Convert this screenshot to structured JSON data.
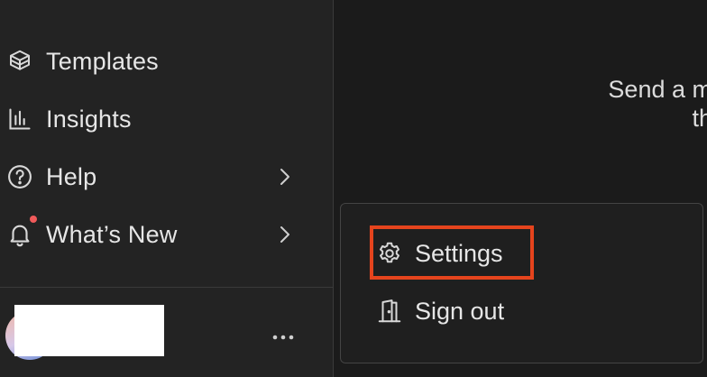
{
  "sidebar": {
    "items": [
      {
        "label": "Templates",
        "icon": "box-stack-icon"
      },
      {
        "label": "Insights",
        "icon": "bar-chart-icon"
      },
      {
        "label": "Help",
        "icon": "question-circle-icon"
      },
      {
        "label": "What’s New",
        "icon": "bell-icon"
      }
    ]
  },
  "main": {
    "line1": "Send a m",
    "line2": "th"
  },
  "menu": {
    "settings_label": "Settings",
    "signout_label": "Sign out"
  },
  "colors": {
    "highlight": "#e5441d",
    "notification_dot": "#f05a5a"
  }
}
